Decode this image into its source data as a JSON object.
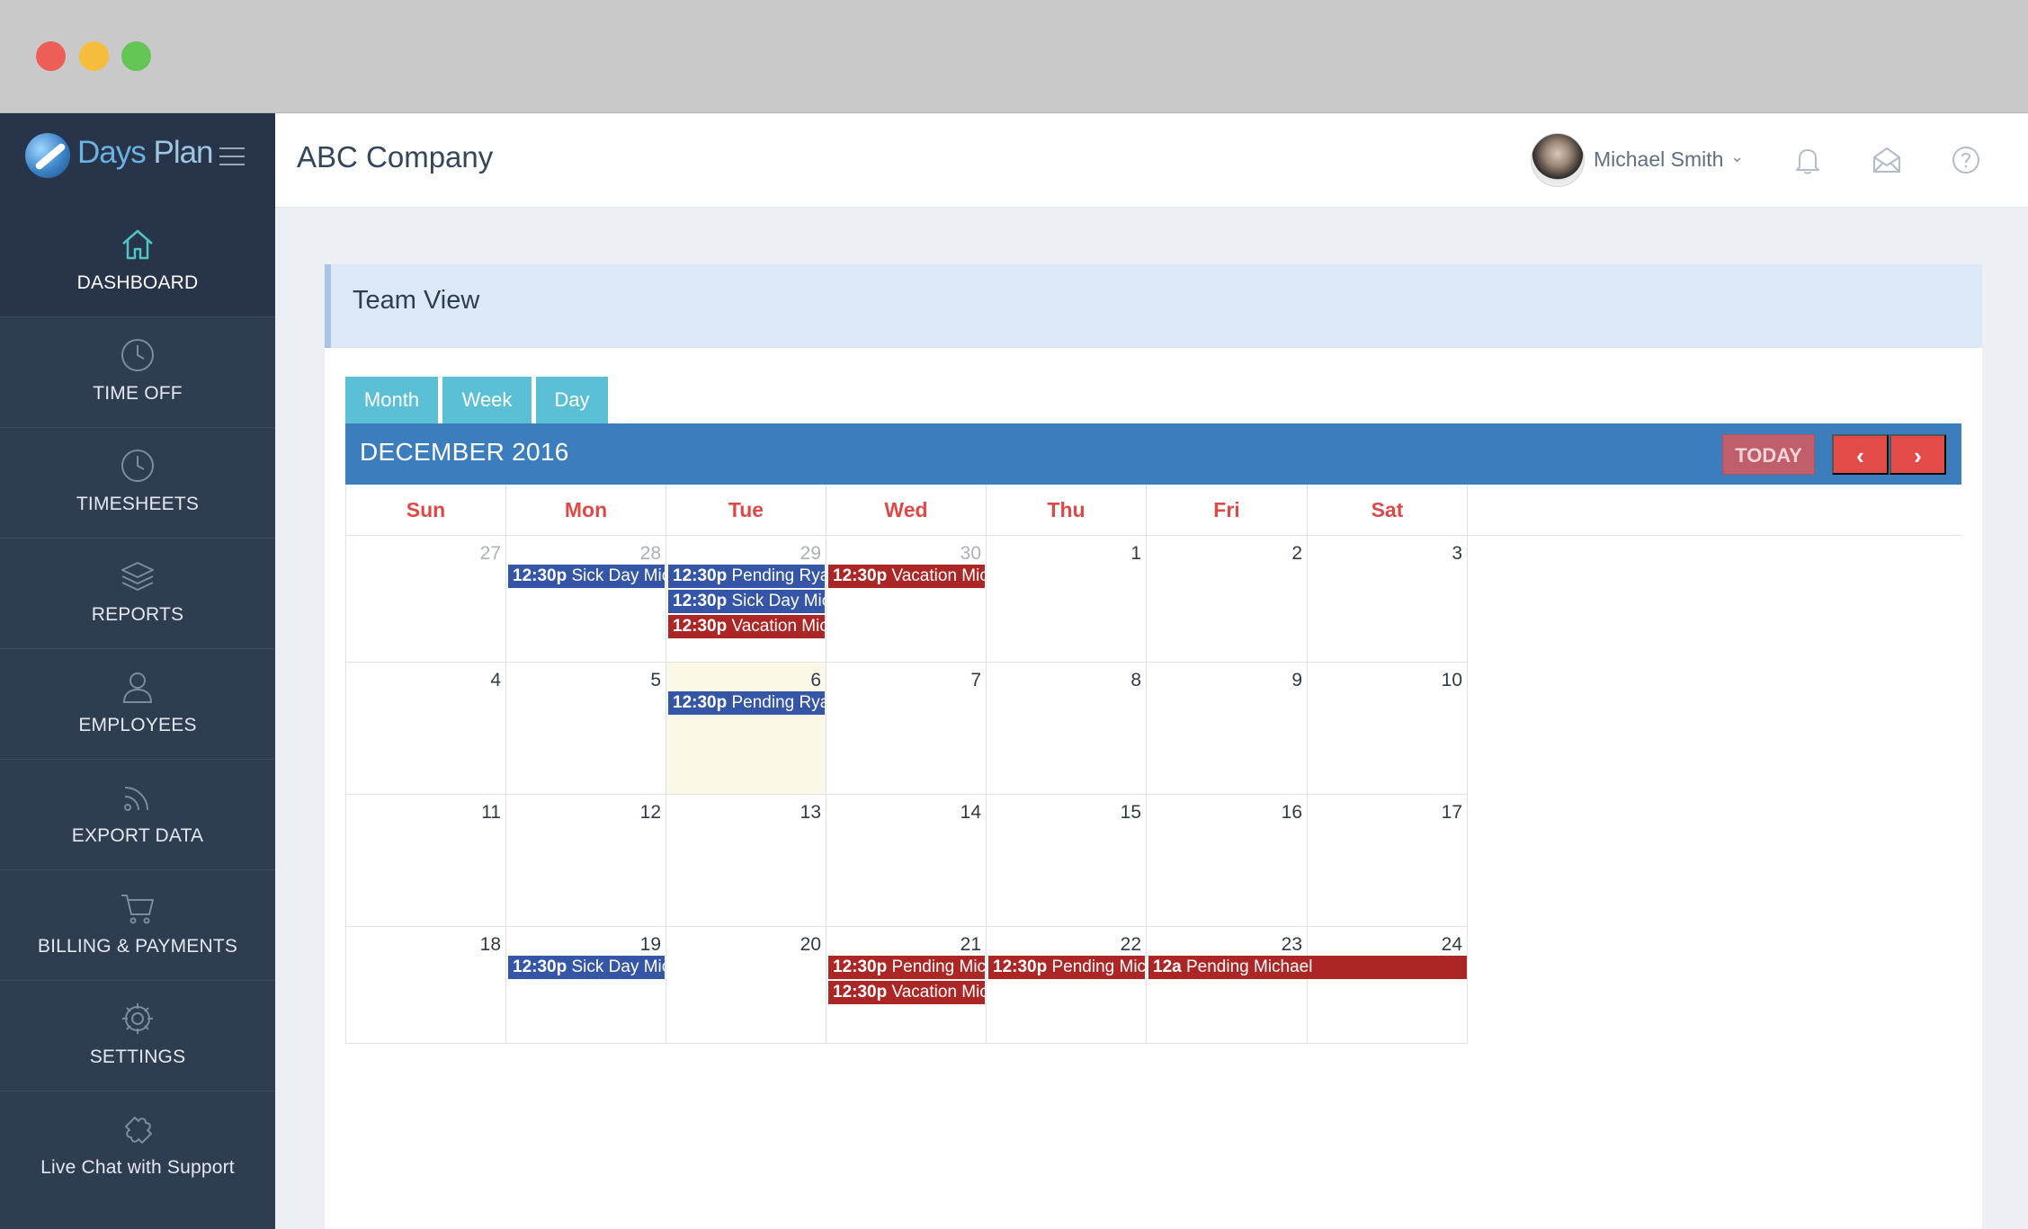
{
  "window": {
    "controls": [
      "close",
      "minimize",
      "maximize"
    ]
  },
  "brand": {
    "name_part1": "Days",
    "name_part2": " Plan"
  },
  "sidebar": {
    "items": [
      {
        "label": "DASHBOARD",
        "icon": "home-icon"
      },
      {
        "label": "TIME OFF",
        "icon": "clock-icon"
      },
      {
        "label": "TIMESHEETS",
        "icon": "clock-icon"
      },
      {
        "label": "REPORTS",
        "icon": "layers-icon"
      },
      {
        "label": "EMPLOYEES",
        "icon": "user-icon"
      },
      {
        "label": "EXPORT DATA",
        "icon": "rss-icon"
      },
      {
        "label": "BILLING & PAYMENTS",
        "icon": "cart-icon"
      },
      {
        "label": "SETTINGS",
        "icon": "gear-icon"
      },
      {
        "label": "Live Chat with Support",
        "icon": "puzzle-icon"
      }
    ]
  },
  "topbar": {
    "company": "ABC Company",
    "user_name": "Michael Smith",
    "user_chevron": "⌄",
    "icons": [
      "bell-icon",
      "mail-icon",
      "help-icon"
    ]
  },
  "panel": {
    "title": "Team View"
  },
  "calendar": {
    "views": [
      "Month",
      "Week",
      "Day"
    ],
    "title": "DECEMBER 2016",
    "today_label": "TODAY",
    "prev_label": "‹",
    "next_label": "›",
    "weekdays": [
      "Sun",
      "Mon",
      "Tue",
      "Wed",
      "Thu",
      "Fri",
      "Sat"
    ],
    "weeks": [
      [
        "27",
        "28",
        "29",
        "30",
        "1",
        "2",
        "3"
      ],
      [
        "4",
        "5",
        "6",
        "7",
        "8",
        "9",
        "10"
      ],
      [
        "11",
        "12",
        "13",
        "14",
        "15",
        "16",
        "17"
      ],
      [
        "18",
        "19",
        "20",
        "21",
        "22",
        "23",
        "24"
      ]
    ],
    "other_month_days": [
      "27",
      "28",
      "29",
      "30"
    ],
    "today": "6",
    "events": [
      {
        "day": "28",
        "time": "12:30p",
        "title": "Sick Day Michael",
        "color": "blue"
      },
      {
        "day": "29",
        "time": "12:30p",
        "title": "Pending Ryan",
        "color": "blue"
      },
      {
        "day": "29",
        "time": "12:30p",
        "title": "Sick Day Michael",
        "color": "blue"
      },
      {
        "day": "29",
        "time": "12:30p",
        "title": "Vacation Michael",
        "color": "red"
      },
      {
        "day": "30",
        "time": "12:30p",
        "title": "Vacation Michael",
        "color": "red"
      },
      {
        "day": "6",
        "time": "12:30p",
        "title": "Pending Ryan",
        "color": "blue"
      },
      {
        "day": "19",
        "time": "12:30p",
        "title": "Sick Day Michael",
        "color": "blue"
      },
      {
        "day": "21",
        "time": "12:30p",
        "title": "Pending Michael",
        "color": "red"
      },
      {
        "day": "21",
        "time": "12:30p",
        "title": "Vacation Michael",
        "color": "red"
      },
      {
        "day": "22",
        "time": "12:30p",
        "title": "Pending Michael",
        "color": "red"
      },
      {
        "day": "23",
        "time": "12a",
        "title": "Pending Michael",
        "color": "red"
      }
    ],
    "colors": {
      "blue": "#3556a7",
      "red": "#ad2626",
      "header": "#3b7dbd",
      "today_bg": "#fbf8e7",
      "weekday_text": "#e04848"
    }
  }
}
